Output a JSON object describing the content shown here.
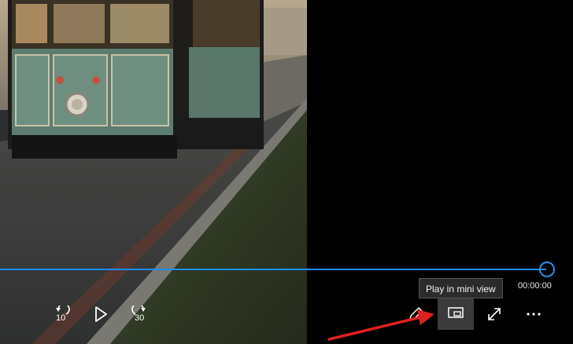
{
  "player": {
    "time_elapsed": "00:00:00",
    "progress_fraction": 1.0,
    "accent_color": "#1f8ded"
  },
  "controls": {
    "rewind_seconds": "10",
    "forward_seconds": "30",
    "rewind_icon": "rewind-10-icon",
    "play_icon": "play-icon",
    "forward_icon": "forward-30-icon",
    "edit_icon": "pencil-icon",
    "mini_view_icon": "mini-view-icon",
    "fullscreen_icon": "expand-icon",
    "more_icon": "more-icon"
  },
  "tooltip": {
    "text": "Play in mini view"
  },
  "annotation": {
    "arrow_color": "#e02020"
  }
}
